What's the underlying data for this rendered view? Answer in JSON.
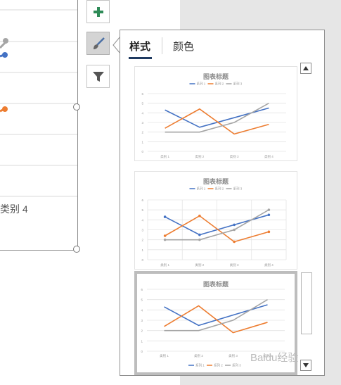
{
  "background_chart": {
    "category_label": "类别 4",
    "series_colors": [
      "#4472c4",
      "#ed7d31",
      "#a5a5a5"
    ]
  },
  "tools": [
    {
      "name": "add-chart-element-button",
      "icon": "plus-icon",
      "active": false
    },
    {
      "name": "chart-styles-button",
      "icon": "paintbrush-icon",
      "active": true
    },
    {
      "name": "chart-filters-button",
      "icon": "funnel-icon",
      "active": false
    }
  ],
  "flyout": {
    "tabs": [
      {
        "label": "样式",
        "selected": true
      },
      {
        "label": "颜色",
        "selected": false
      }
    ],
    "accent_color": "#1f3a60"
  },
  "chart_data": [
    {
      "type": "line",
      "title": "图表标题",
      "categories": [
        "类别 1",
        "类别 2",
        "类别 3",
        "类别 4"
      ],
      "ylim": [
        0,
        6
      ],
      "yticks": [
        "0",
        "1",
        "2",
        "3",
        "4",
        "5",
        "6"
      ],
      "legend_position": "top",
      "grid": "horizontal",
      "series": [
        {
          "name": "系列 1",
          "values": [
            4.3,
            2.5,
            3.5,
            4.5
          ],
          "color": "#4472c4"
        },
        {
          "name": "系列 2",
          "values": [
            2.4,
            4.4,
            1.8,
            2.8
          ],
          "color": "#ed7d31"
        },
        {
          "name": "系列 3",
          "values": [
            2,
            2,
            3,
            5
          ],
          "color": "#a5a5a5"
        }
      ]
    },
    {
      "type": "line",
      "title": "图表标题",
      "categories": [
        "类别 1",
        "类别 2",
        "类别 3",
        "类别 4"
      ],
      "ylim": [
        0,
        6
      ],
      "yticks": [
        "0",
        "1",
        "2",
        "3",
        "4",
        "5",
        "6"
      ],
      "legend_position": "top",
      "grid": "both",
      "markers": true,
      "series": [
        {
          "name": "系列 1",
          "values": [
            4.3,
            2.5,
            3.5,
            4.5
          ],
          "color": "#4472c4"
        },
        {
          "name": "系列 2",
          "values": [
            2.4,
            4.4,
            1.8,
            2.8
          ],
          "color": "#ed7d31"
        },
        {
          "name": "系列 3",
          "values": [
            2,
            2,
            3,
            5
          ],
          "color": "#a5a5a5"
        }
      ]
    },
    {
      "type": "line",
      "title": "图表标题",
      "categories": [
        "类别 1",
        "类别 2",
        "类别 3",
        "类别 4"
      ],
      "ylim": [
        0,
        6
      ],
      "yticks": [
        "0",
        "1",
        "2",
        "3",
        "4",
        "5",
        "6"
      ],
      "legend_position": "bottom",
      "grid": "horizontal",
      "selected": true,
      "series": [
        {
          "name": "系列 1",
          "values": [
            4.3,
            2.5,
            3.5,
            4.5
          ],
          "color": "#4472c4"
        },
        {
          "name": "系列 2",
          "values": [
            2.4,
            4.4,
            1.8,
            2.8
          ],
          "color": "#ed7d31"
        },
        {
          "name": "系列 3",
          "values": [
            2,
            2,
            3,
            5
          ],
          "color": "#a5a5a5"
        }
      ]
    }
  ],
  "scrollbar": {
    "up_icon": "triangle-up-icon",
    "down_icon": "triangle-down-icon"
  },
  "watermark": "Baidu经验"
}
